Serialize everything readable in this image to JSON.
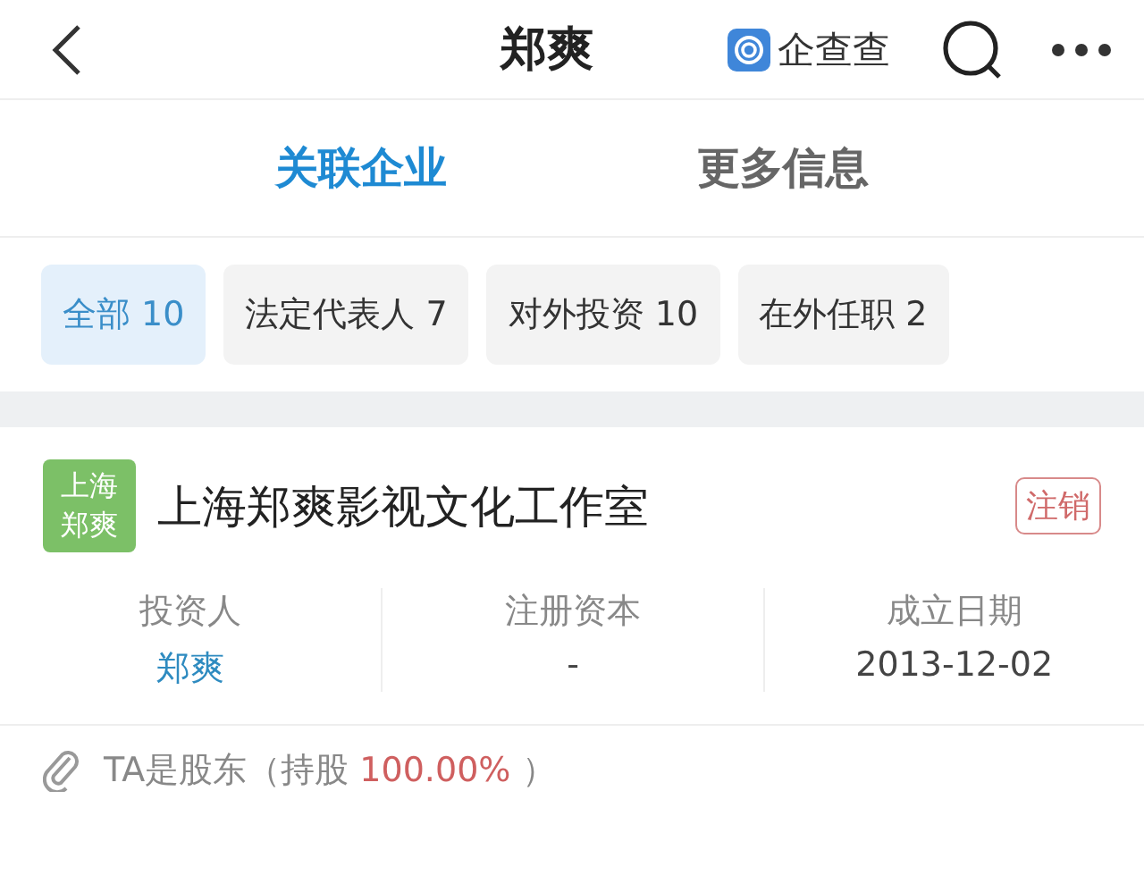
{
  "header": {
    "title": "郑爽",
    "brand": "企查查"
  },
  "tabs": [
    {
      "label": "关联企业",
      "selected": true
    },
    {
      "label": "更多信息",
      "selected": false
    }
  ],
  "filters": [
    {
      "label": "全部 10",
      "selected": true
    },
    {
      "label": "法定代表人 7",
      "selected": false
    },
    {
      "label": "对外投资 10",
      "selected": false
    },
    {
      "label": "在外任职 2",
      "selected": false
    }
  ],
  "company": {
    "logo_text": "上海郑爽",
    "name": "上海郑爽影视文化工作室",
    "status": "注销",
    "fields": [
      {
        "label": "投资人",
        "value": "郑爽",
        "kind": "link"
      },
      {
        "label": "注册资本",
        "value": "-",
        "kind": "text"
      },
      {
        "label": "成立日期",
        "value": "2013-12-02",
        "kind": "text"
      }
    ],
    "shareholding": {
      "prefix": "TA是股东（持股 ",
      "percent": "100.00%",
      "suffix": " ）"
    }
  }
}
